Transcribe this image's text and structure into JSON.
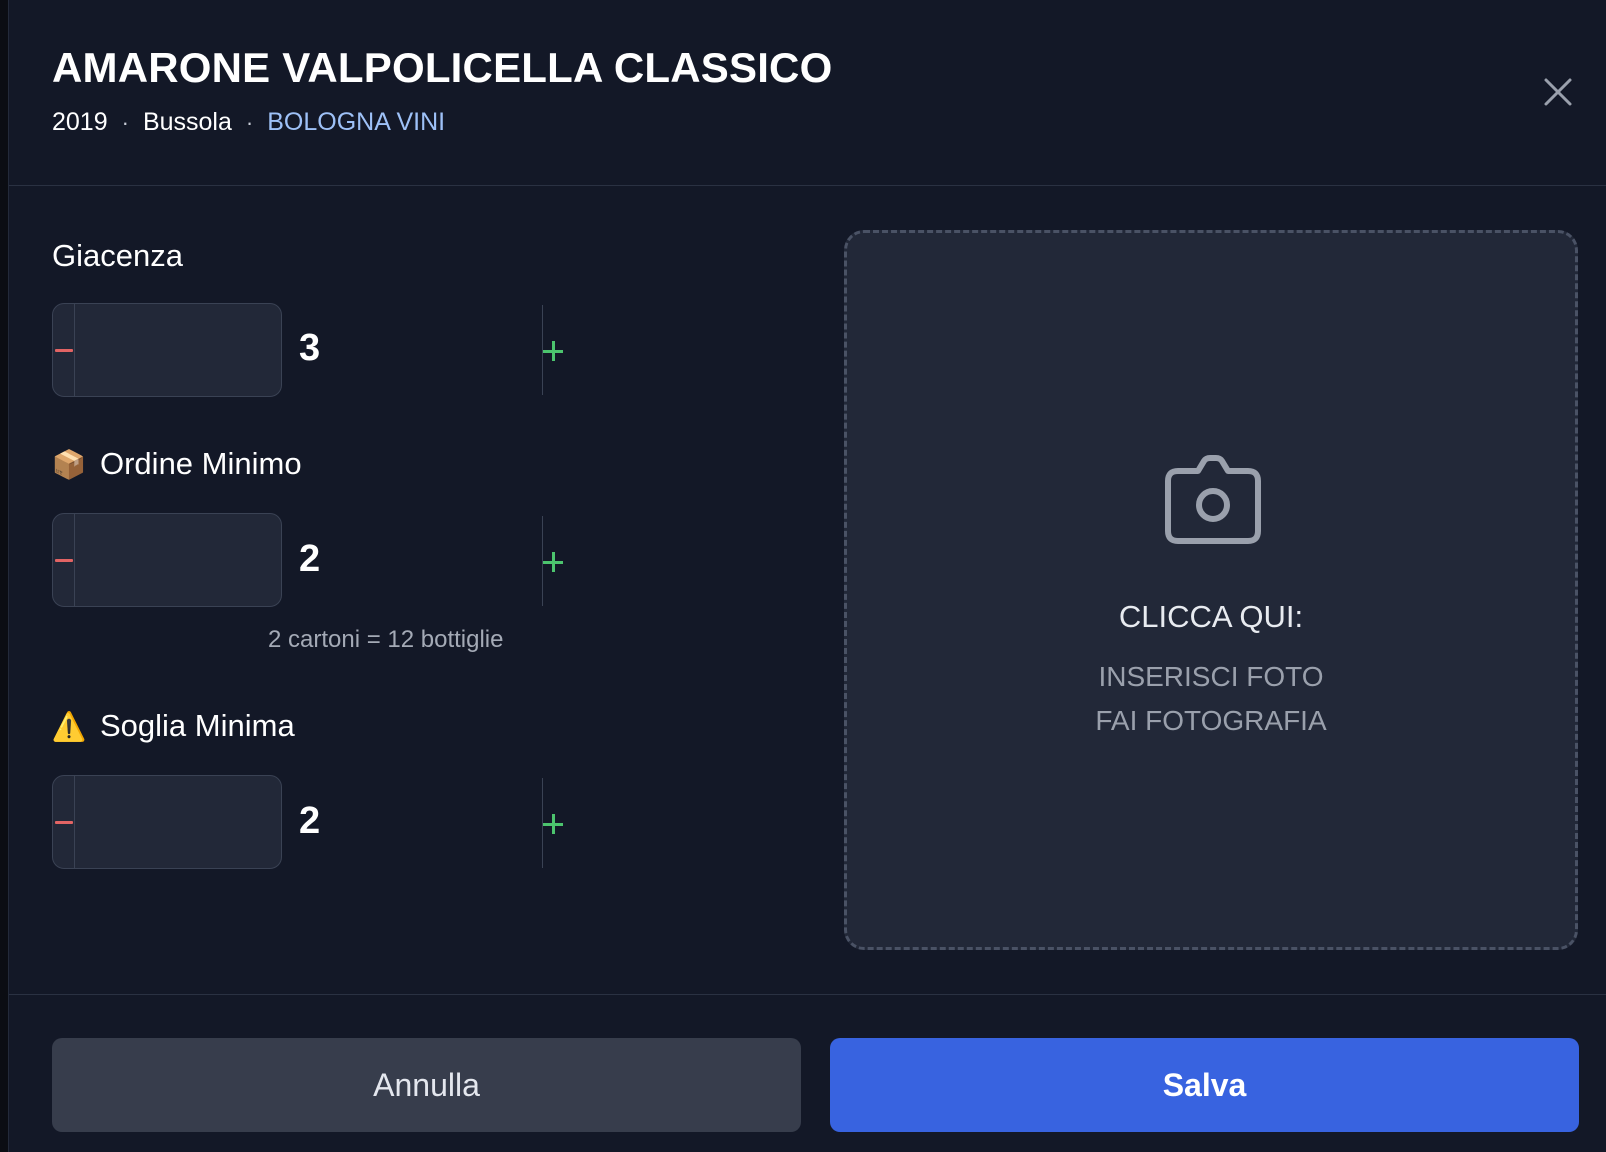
{
  "header": {
    "title": "AMARONE VALPOLICELLA CLASSICO",
    "vintage": "2019",
    "producer": "Bussola",
    "supplier": "BOLOGNA VINI",
    "separator": "·",
    "close_icon": "close-icon"
  },
  "giacenza": {
    "label": "Giacenza",
    "value": "3"
  },
  "ordine_minimo": {
    "icon": "📦",
    "label": "Ordine Minimo",
    "value": "2",
    "hint": "2 cartoni = 12 bottiglie"
  },
  "soglia_minima": {
    "icon": "⚠️",
    "label": "Soglia Minima",
    "value": "2"
  },
  "photo": {
    "icon": "camera-icon",
    "title": "CLICCA QUI:",
    "line1": "INSERISCI FOTO",
    "line2": "FAI FOTOGRAFIA"
  },
  "footer": {
    "cancel_label": "Annulla",
    "save_label": "Salva"
  },
  "colors": {
    "background": "#131827",
    "input_bg": "#222838",
    "minus": "#e26464",
    "plus": "#4cc46e",
    "supplier_link": "#9ec1f7",
    "primary": "#3863e0",
    "secondary": "#373d4c"
  }
}
